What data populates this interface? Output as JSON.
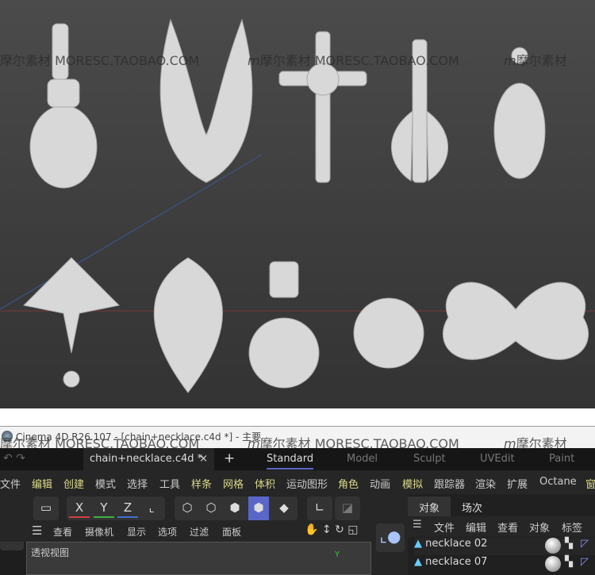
{
  "watermark": {
    "brand_cn": "摩尔素材",
    "brand_url": "MORESC.TAOBAO.COM",
    "logo_glyph": "m"
  },
  "window": {
    "title": "Cinema 4D R26.107 - [chain+necklace.c4d *] - 主要"
  },
  "file_tab": {
    "label": "chain+necklace.c4d *",
    "close": "×",
    "add": "+"
  },
  "layouts": [
    "Standard",
    "Model",
    "Sculpt",
    "UVEdit",
    "Paint"
  ],
  "menu": [
    "文件",
    "编辑",
    "创建",
    "模式",
    "选择",
    "工具",
    "样条",
    "网格",
    "体积",
    "运动图形",
    "角色",
    "动画",
    "模拟",
    "跟踪器",
    "渲染",
    "扩展",
    "Octane",
    "窗"
  ],
  "axes": {
    "x": "X",
    "y": "Y",
    "z": "Z"
  },
  "view_menu": [
    "查看",
    "摄像机",
    "显示",
    "选项",
    "过滤",
    "面板"
  ],
  "viewport": {
    "label": "透视视图"
  },
  "object_panel": {
    "tabs": [
      "对象",
      "场次"
    ],
    "menu": [
      "文件",
      "编辑",
      "查看",
      "对象",
      "标签"
    ],
    "objects": [
      "necklace 02",
      "necklace 07"
    ]
  },
  "colors": {
    "accent": "#5a66c8",
    "x": "#d04040",
    "y": "#40b040",
    "z": "#4070d0"
  }
}
